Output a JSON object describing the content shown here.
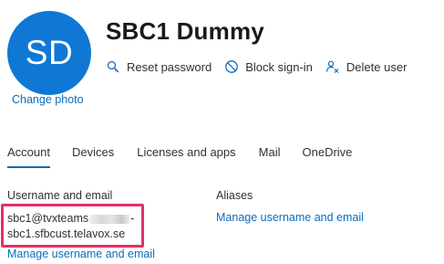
{
  "profile": {
    "initials": "SD",
    "change_photo": "Change photo",
    "name": "SBC1 Dummy"
  },
  "actions": {
    "reset_password": "Reset password",
    "block_signin": "Block sign-in",
    "delete_user": "Delete user"
  },
  "tabs": [
    {
      "label": "Account",
      "active": true
    },
    {
      "label": "Devices"
    },
    {
      "label": "Licenses and apps"
    },
    {
      "label": "Mail"
    },
    {
      "label": "OneDrive"
    }
  ],
  "account": {
    "username_label": "Username and email",
    "email_line1_prefix": "sbc1@tvxteams",
    "email_line1_suffix": "-",
    "email_line2": "sbc1.sfbcust.telavox.se",
    "manage_username_link": "Manage username and email",
    "aliases_label": "Aliases",
    "manage_aliases_link": "Manage username and email"
  },
  "colors": {
    "avatar_bg": "#0f78d4",
    "link": "#0a6cbd",
    "highlight_box": "#e3306a",
    "tab_underline": "#0f6cbd"
  },
  "icons": {
    "reset": "key-search-icon",
    "block": "block-icon",
    "delete": "delete-user-icon"
  }
}
